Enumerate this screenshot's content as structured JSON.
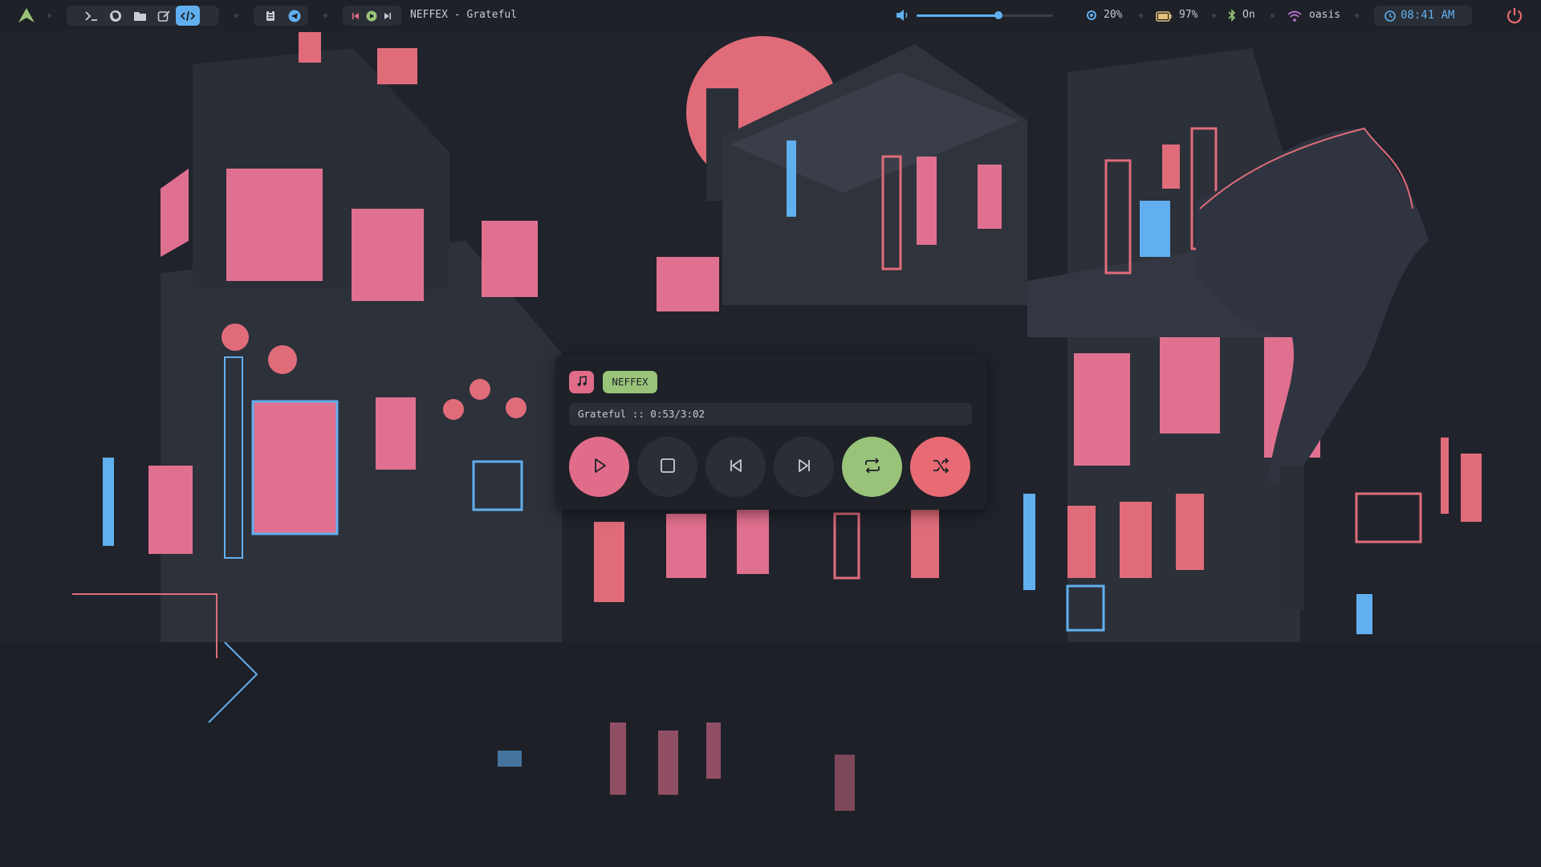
{
  "colors": {
    "accent_blue": "#61afef",
    "accent_pink": "#e06c8a",
    "accent_green": "#98c379",
    "accent_red": "#e86a74",
    "bar_bg": "#1e2127",
    "pill_bg": "#2a2e36"
  },
  "topbar": {
    "launcher_icon": "arch-logo-icon",
    "apps": [
      {
        "icon": "terminal-icon"
      },
      {
        "icon": "firefox-icon"
      },
      {
        "icon": "folder-icon"
      },
      {
        "icon": "editor-icon"
      },
      {
        "icon": "code-icon",
        "active": true
      }
    ],
    "tray": [
      {
        "icon": "clipboard-icon"
      },
      {
        "icon": "telegram-icon"
      }
    ],
    "now_playing": "NEFFEX - Grateful",
    "volume_percent": 60,
    "brightness": "20%",
    "battery": "97%",
    "bluetooth": "On",
    "wifi": "oasis",
    "clock": "08:41 AM",
    "power_icon": "power-icon"
  },
  "player": {
    "artist": "NEFFEX",
    "status": "Grateful :: 0:53/3:02",
    "controls": [
      "play",
      "stop",
      "previous",
      "next",
      "repeat",
      "shuffle"
    ]
  }
}
